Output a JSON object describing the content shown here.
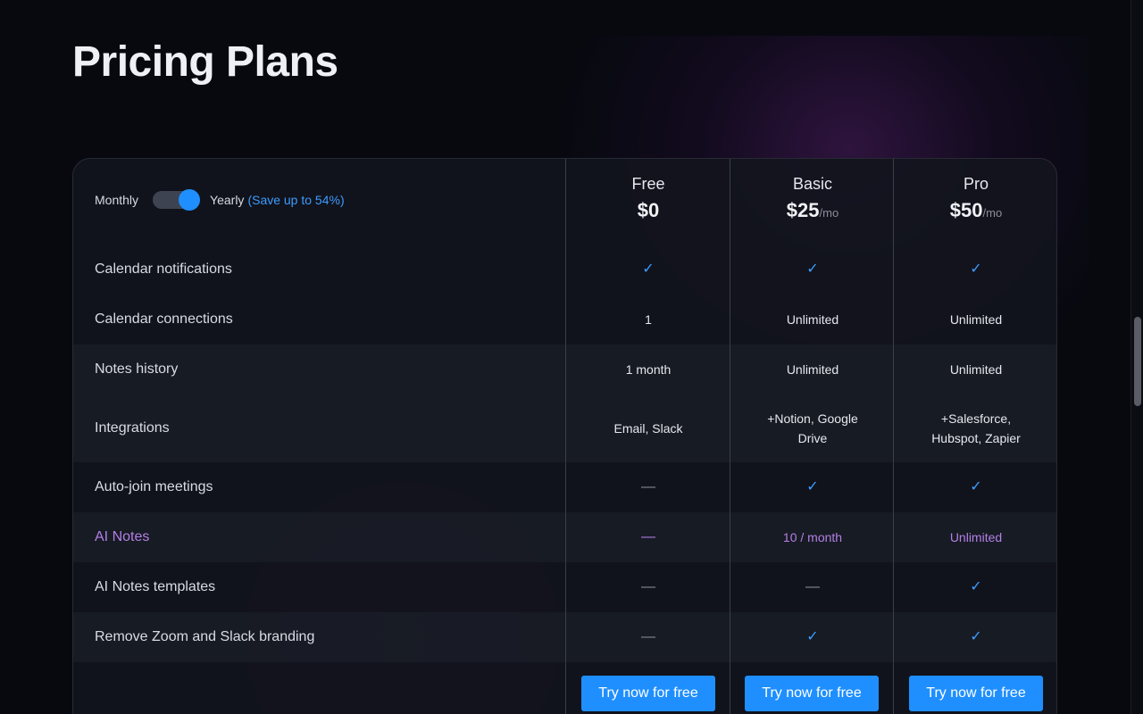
{
  "page": {
    "title": "Pricing Plans"
  },
  "billing_toggle": {
    "monthly_label": "Monthly",
    "yearly_label": "Yearly",
    "save_label": "(Save up to 54%)",
    "selected": "Yearly"
  },
  "plans": [
    {
      "name": "Free",
      "price": "$0",
      "period": ""
    },
    {
      "name": "Basic",
      "price": "$25",
      "period": "/mo"
    },
    {
      "name": "Pro",
      "price": "$50",
      "period": "/mo"
    }
  ],
  "features": [
    {
      "label": "Calendar notifications",
      "values": [
        "check",
        "check",
        "check"
      ]
    },
    {
      "label": "Calendar connections",
      "values": [
        "1",
        "Unlimited",
        "Unlimited"
      ]
    },
    {
      "label": "Notes history",
      "values": [
        "1 month",
        "Unlimited",
        "Unlimited"
      ]
    },
    {
      "label": "Integrations",
      "values": [
        "Email, Slack",
        "+Notion, Google Drive",
        "+Salesforce, Hubspot, Zapier"
      ]
    },
    {
      "label": "Auto-join meetings",
      "values": [
        "dash",
        "check",
        "check"
      ]
    },
    {
      "label": "AI Notes",
      "values": [
        "dash",
        "10 / month",
        "Unlimited"
      ]
    },
    {
      "label": "AI Notes templates",
      "values": [
        "dash",
        "dash",
        "check"
      ]
    },
    {
      "label": "Remove Zoom and Slack branding",
      "values": [
        "dash",
        "check",
        "check"
      ]
    }
  ],
  "cta_label": "Try now for free",
  "glyphs": {
    "check": "✓",
    "dash": "—"
  },
  "colors": {
    "accent": "#1f8fff",
    "ai": "#b47fe6",
    "background": "#07090f"
  }
}
